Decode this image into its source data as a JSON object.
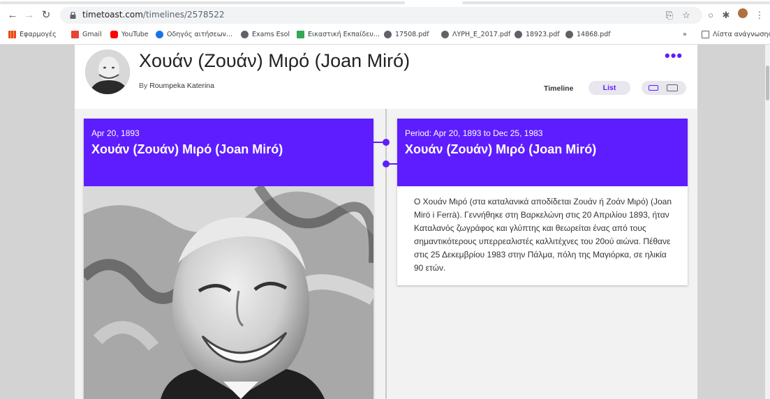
{
  "browser": {
    "url_host": "timetoast.com",
    "url_path": "/timelines/2578522",
    "bookmarks": [
      {
        "label": "Εφαρμογές",
        "color": "#4285f4"
      },
      {
        "label": "Gmail",
        "color": "#ea4335"
      },
      {
        "label": "YouTube",
        "color": "#ff0000"
      },
      {
        "label": "Οδηγός αιτήσεων...",
        "color": "#1a73e8"
      },
      {
        "label": "Exams Esol",
        "color": "#5f6368"
      },
      {
        "label": "Εικαστική Εκπαίδευ...",
        "color": "#34a853"
      },
      {
        "label": "17508.pdf",
        "color": "#5f6368"
      },
      {
        "label": "ΛΥΡΗ_Ε_2017.pdf",
        "color": "#5f6368"
      },
      {
        "label": "18923.pdf",
        "color": "#5f6368"
      },
      {
        "label": "14868.pdf",
        "color": "#5f6368"
      }
    ],
    "more_bookmarks": "»",
    "reading_list": "Λίστα ανάγνωσης"
  },
  "header": {
    "title": "Χουάν (Ζουάν) Μιρό (Joan Miró)",
    "by_prefix": "By",
    "author": "Roumpeka Katerina",
    "more": "•••",
    "tab_timeline": "Timeline",
    "tab_list": "List"
  },
  "event": {
    "date": "Apr 20, 1893",
    "title": "Χουάν (Ζουάν) Μιρό (Joan Miró)"
  },
  "period": {
    "date": "Period: Apr 20, 1893 to Dec 25, 1983",
    "title": "Χουάν (Ζουάν) Μιρό (Joan Miró)",
    "description": "Ο Χουάν Μιρό (στα καταλανικά αποδίδεται Ζουάν ή Ζοάν Μιρό) (Joan Miró i Ferrà). Γεννήθηκε στη Βαρκελώνη στις 20 Απριλίου 1893, ήταν Καταλανός ζωγράφος και γλύπτης και θεωρείται ένας από τους σημαντικότερους υπερρεαλιστές καλλιτέχνες του 20ού αιώνα. Πέθανε στις 25 Δεκεμβρίου 1983 στην Πάλμα, πόλη της Μαγιόρκα, σε ηλικία 90 ετών."
  },
  "colors": {
    "accent": "#5e1dff"
  }
}
